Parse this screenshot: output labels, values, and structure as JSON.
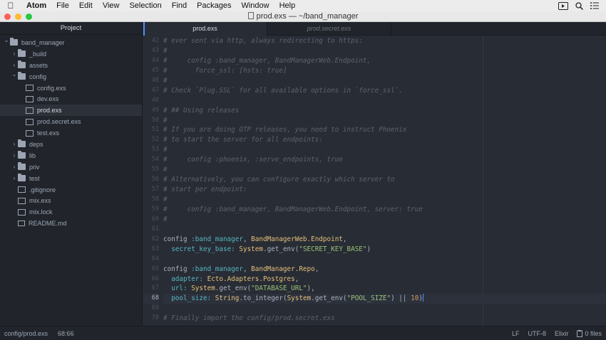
{
  "menubar": {
    "items": [
      "Atom",
      "File",
      "Edit",
      "View",
      "Selection",
      "Find",
      "Packages",
      "Window",
      "Help"
    ]
  },
  "window": {
    "title": "prod.exs — ~/band_manager"
  },
  "tree": {
    "header": "Project",
    "rows": [
      {
        "label": "band_manager",
        "kind": "folder",
        "depth": 0,
        "expanded": true
      },
      {
        "label": "_build",
        "kind": "folder",
        "depth": 1,
        "expanded": false
      },
      {
        "label": "assets",
        "kind": "folder",
        "depth": 1,
        "expanded": false
      },
      {
        "label": "config",
        "kind": "folder",
        "depth": 1,
        "expanded": true
      },
      {
        "label": "config.exs",
        "kind": "file",
        "depth": 2
      },
      {
        "label": "dev.exs",
        "kind": "file",
        "depth": 2
      },
      {
        "label": "prod.exs",
        "kind": "file",
        "depth": 2,
        "selected": true
      },
      {
        "label": "prod.secret.exs",
        "kind": "file",
        "depth": 2
      },
      {
        "label": "test.exs",
        "kind": "file",
        "depth": 2
      },
      {
        "label": "deps",
        "kind": "folder",
        "depth": 1,
        "expanded": false
      },
      {
        "label": "lib",
        "kind": "folder",
        "depth": 1,
        "expanded": false
      },
      {
        "label": "priv",
        "kind": "folder",
        "depth": 1,
        "expanded": false
      },
      {
        "label": "test",
        "kind": "folder",
        "depth": 1,
        "expanded": false
      },
      {
        "label": ".gitignore",
        "kind": "file",
        "depth": 1
      },
      {
        "label": "mix.exs",
        "kind": "file",
        "depth": 1
      },
      {
        "label": "mix.lock",
        "kind": "file",
        "depth": 1
      },
      {
        "label": "README.md",
        "kind": "file-rich",
        "depth": 1
      }
    ]
  },
  "tabs": [
    {
      "label": "prod.exs",
      "active": true
    },
    {
      "label": "prod.secret.exs",
      "active": false
    }
  ],
  "editor": {
    "current_line": 68,
    "lines": [
      {
        "n": 42,
        "tokens": [
          [
            "cm",
            "# ever sent via http, always redirecting to https:"
          ]
        ]
      },
      {
        "n": 43,
        "tokens": [
          [
            "cm",
            "#"
          ]
        ]
      },
      {
        "n": 44,
        "tokens": [
          [
            "cm",
            "#     config :band_manager, BandManagerWeb.Endpoint,"
          ]
        ]
      },
      {
        "n": 45,
        "tokens": [
          [
            "cm",
            "#       force_ssl: [hsts: true]"
          ]
        ]
      },
      {
        "n": 46,
        "tokens": [
          [
            "cm",
            "#"
          ]
        ]
      },
      {
        "n": 47,
        "tokens": [
          [
            "cm",
            "# Check `Plug.SSL` for all available options in `force_ssl`."
          ]
        ]
      },
      {
        "n": 48,
        "tokens": []
      },
      {
        "n": 49,
        "tokens": [
          [
            "cm",
            "# ## Using releases"
          ]
        ]
      },
      {
        "n": 50,
        "tokens": [
          [
            "cm",
            "#"
          ]
        ]
      },
      {
        "n": 51,
        "tokens": [
          [
            "cm",
            "# If you are doing OTP releases, you need to instruct Phoenix"
          ]
        ]
      },
      {
        "n": 52,
        "tokens": [
          [
            "cm",
            "# to start the server for all endpoints:"
          ]
        ]
      },
      {
        "n": 53,
        "tokens": [
          [
            "cm",
            "#"
          ]
        ]
      },
      {
        "n": 54,
        "tokens": [
          [
            "cm",
            "#     config :phoenix, :serve_endpoints, true"
          ]
        ]
      },
      {
        "n": 55,
        "tokens": [
          [
            "cm",
            "#"
          ]
        ]
      },
      {
        "n": 56,
        "tokens": [
          [
            "cm",
            "# Alternatively, you can configure exactly which server to"
          ]
        ]
      },
      {
        "n": 57,
        "tokens": [
          [
            "cm",
            "# start per endpoint:"
          ]
        ]
      },
      {
        "n": 58,
        "tokens": [
          [
            "cm",
            "#"
          ]
        ]
      },
      {
        "n": 59,
        "tokens": [
          [
            "cm",
            "#     config :band_manager, BandManagerWeb.Endpoint, server: true"
          ]
        ]
      },
      {
        "n": 60,
        "tokens": [
          [
            "cm",
            "#"
          ]
        ]
      },
      {
        "n": 61,
        "tokens": []
      },
      {
        "n": 62,
        "tokens": [
          [
            "pl",
            "config "
          ],
          [
            "at",
            ":band_manager"
          ],
          [
            "pl",
            ", "
          ],
          [
            "mod",
            "BandManagerWeb.Endpoint"
          ],
          [
            "pl",
            ","
          ]
        ]
      },
      {
        "n": 63,
        "tokens": [
          [
            "pl",
            "  "
          ],
          [
            "at",
            "secret_key_base:"
          ],
          [
            "pl",
            " "
          ],
          [
            "mod",
            "System"
          ],
          [
            "pl",
            ".get_env("
          ],
          [
            "str",
            "\"SECRET_KEY_BASE\""
          ],
          [
            "pl",
            ")"
          ]
        ]
      },
      {
        "n": 64,
        "tokens": []
      },
      {
        "n": 65,
        "tokens": [
          [
            "pl",
            "config "
          ],
          [
            "at",
            ":band_manager"
          ],
          [
            "pl",
            ", "
          ],
          [
            "mod",
            "BandManager.Repo"
          ],
          [
            "pl",
            ","
          ]
        ]
      },
      {
        "n": 66,
        "tokens": [
          [
            "pl",
            "  "
          ],
          [
            "at",
            "adapter:"
          ],
          [
            "pl",
            " "
          ],
          [
            "mod",
            "Ecto.Adapters.Postgres"
          ],
          [
            "pl",
            ","
          ]
        ]
      },
      {
        "n": 67,
        "tokens": [
          [
            "pl",
            "  "
          ],
          [
            "at",
            "url:"
          ],
          [
            "pl",
            " "
          ],
          [
            "mod",
            "System"
          ],
          [
            "pl",
            ".get_env("
          ],
          [
            "str",
            "\"DATABASE_URL\""
          ],
          [
            "pl",
            "),"
          ]
        ]
      },
      {
        "n": 68,
        "tokens": [
          [
            "pl",
            "  "
          ],
          [
            "at",
            "pool_size:"
          ],
          [
            "pl",
            " "
          ],
          [
            "mod",
            "String"
          ],
          [
            "pl",
            ".to_integer("
          ],
          [
            "mod",
            "System"
          ],
          [
            "pl",
            ".get_env("
          ],
          [
            "str",
            "\"POOL_SIZE\""
          ],
          [
            "pl",
            ") || "
          ],
          [
            "num",
            "10"
          ],
          [
            "pl",
            ")"
          ]
        ]
      },
      {
        "n": 69,
        "tokens": []
      },
      {
        "n": 70,
        "tokens": [
          [
            "cm",
            "# Finally import the config/prod.secret.exs"
          ]
        ]
      }
    ]
  },
  "statusbar": {
    "path": "config/prod.exs",
    "cursor": "68:66",
    "line_ending": "LF",
    "encoding": "UTF-8",
    "grammar": "Elixir",
    "files": "0 files"
  }
}
